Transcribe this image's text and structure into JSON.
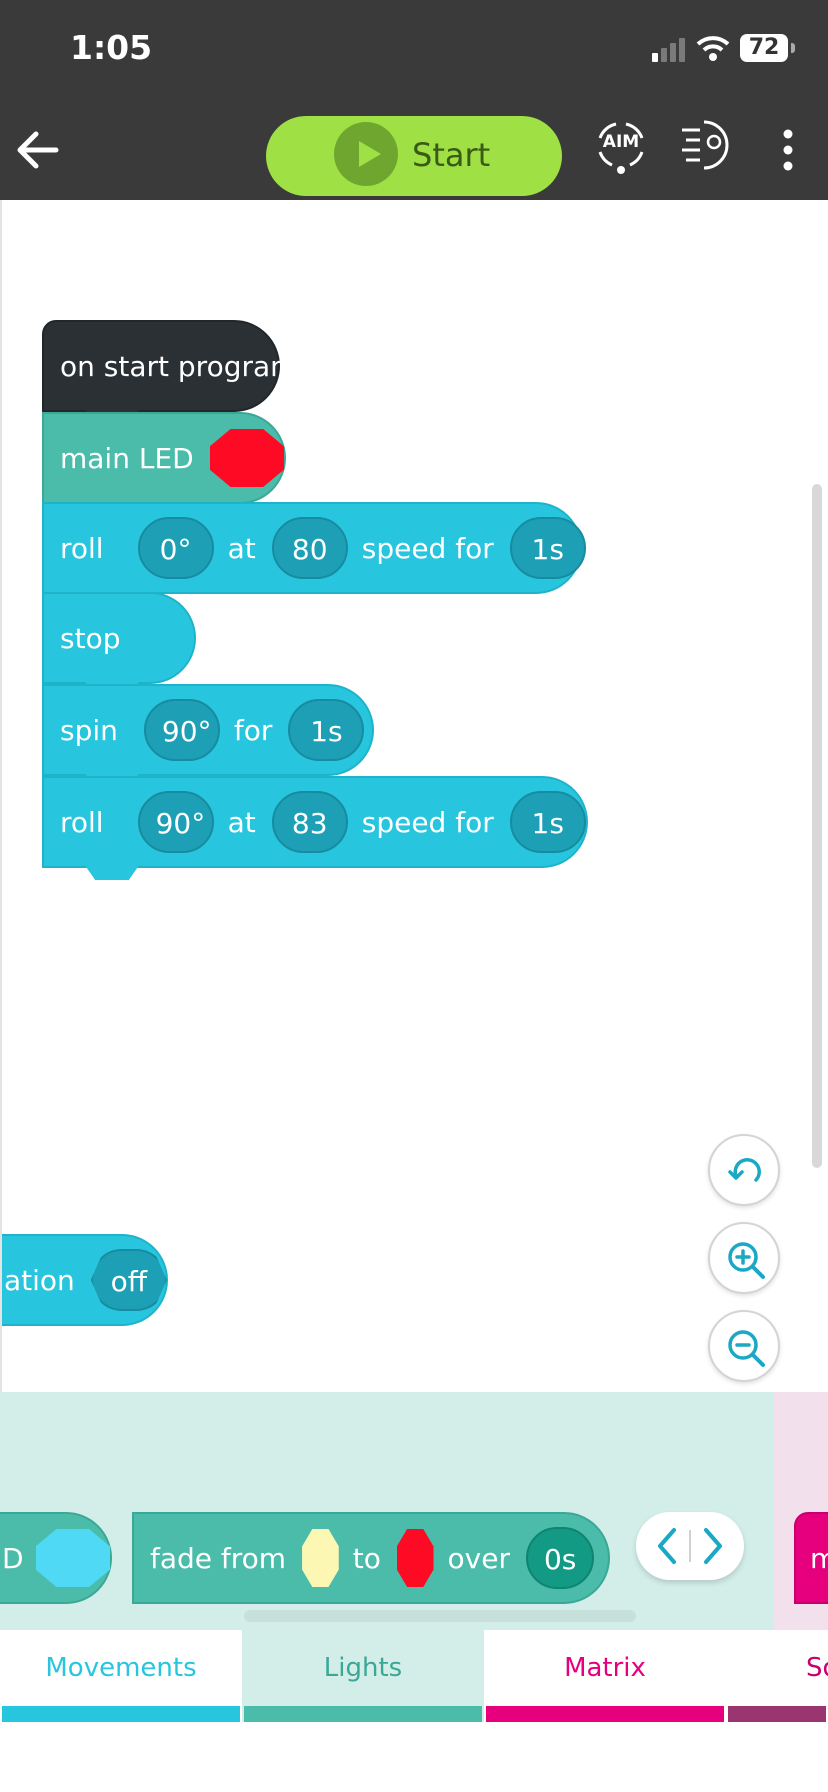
{
  "status_bar": {
    "time": "1:05",
    "battery": "72"
  },
  "toolbar": {
    "start_label": "Start",
    "aim_label": "AIM"
  },
  "program": {
    "hat": {
      "label": "on start program"
    },
    "main_led": {
      "label": "main LED",
      "color": "#ff0a24"
    },
    "roll1": {
      "label": "roll",
      "heading": "0°",
      "at": "at",
      "speed": "80",
      "speed_for": "speed for",
      "duration": "1s"
    },
    "stop": {
      "label": "stop"
    },
    "spin": {
      "label": "spin",
      "degrees": "90°",
      "for": "for",
      "duration": "1s"
    },
    "roll2": {
      "label": "roll",
      "heading": "90°",
      "at": "at",
      "speed": "83",
      "speed_for": "speed for",
      "duration": "1s"
    }
  },
  "stray_block": {
    "label": "ation",
    "value": "off"
  },
  "palette": {
    "partial_left": {
      "label": "D",
      "color": "#4fd9f5"
    },
    "fade": {
      "label": "fade from",
      "from_color": "#fdf7b4",
      "to": "to",
      "to_color": "#ff0a24",
      "over": "over",
      "duration": "0s"
    },
    "partial_right": {
      "label": "m"
    }
  },
  "tabs": [
    {
      "label": "Movements",
      "color": "#27c6de"
    },
    {
      "label": "Lights",
      "color": "#4abca9"
    },
    {
      "label": "Matrix",
      "color": "#e6007e"
    },
    {
      "label": "So",
      "color": "#9a3572"
    }
  ]
}
